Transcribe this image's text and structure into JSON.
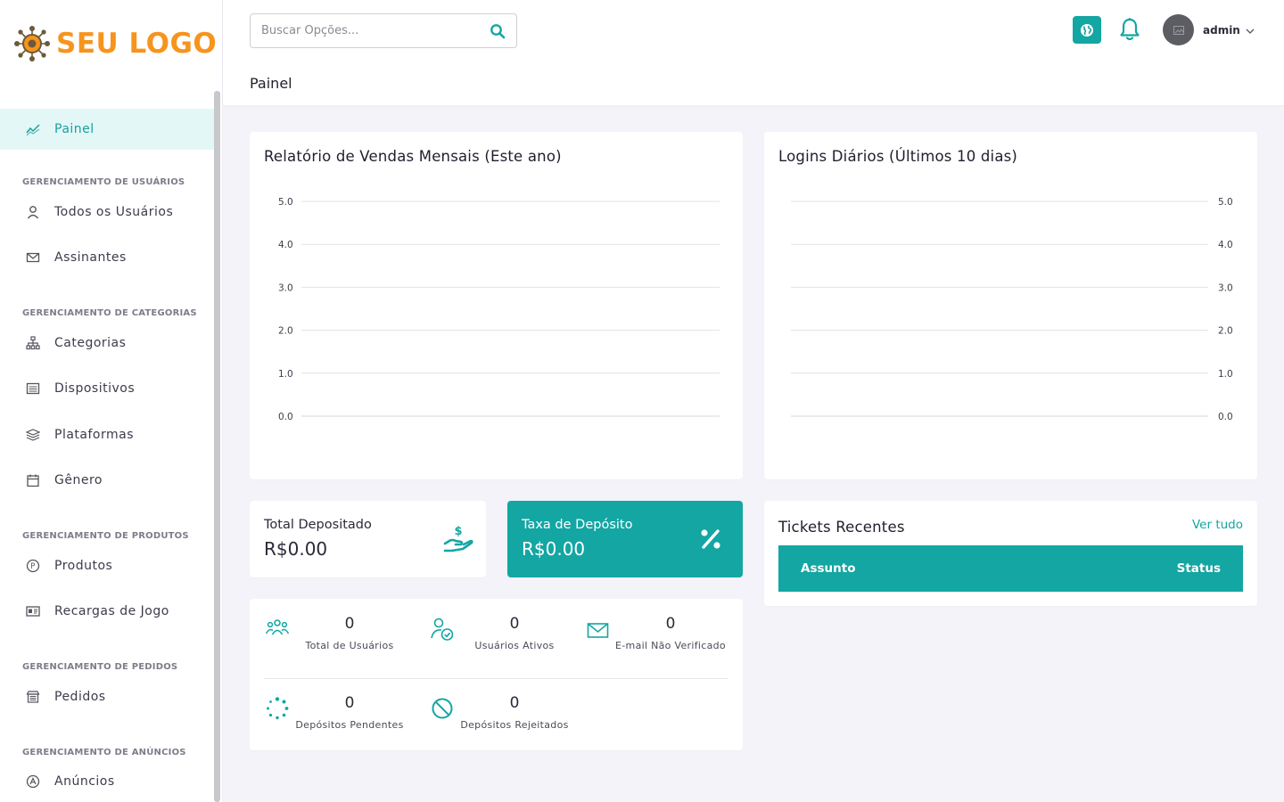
{
  "brand": {
    "logo_text": "SEU LOGO",
    "logo_color": "#f7941d",
    "accent": "#13a6a3"
  },
  "sidebar": {
    "items": [
      {
        "type": "item",
        "label": "Painel",
        "icon": "chart-line-icon",
        "active": true
      },
      {
        "type": "header",
        "label": "GERENCIAMENTO DE USUÁRIOS"
      },
      {
        "type": "item",
        "label": "Todos os Usuários",
        "icon": "user-icon"
      },
      {
        "type": "item",
        "label": "Assinantes",
        "icon": "envelope-icon"
      },
      {
        "type": "header",
        "label": "GERENCIAMENTO DE CATEGORIAS"
      },
      {
        "type": "item",
        "label": "Categorias",
        "icon": "sitemap-icon"
      },
      {
        "type": "item",
        "label": "Dispositivos",
        "icon": "list-box-icon"
      },
      {
        "type": "item",
        "label": "Plataformas",
        "icon": "layers-icon"
      },
      {
        "type": "item",
        "label": "Gênero",
        "icon": "calendar-icon"
      },
      {
        "type": "header",
        "label": "GERENCIAMENTO DE PRODUTOS"
      },
      {
        "type": "item",
        "label": "Produtos",
        "icon": "product-circle-icon"
      },
      {
        "type": "item",
        "label": "Recargas de Jogo",
        "icon": "id-card-icon"
      },
      {
        "type": "header",
        "label": "GERENCIAMENTO DE PEDIDOS"
      },
      {
        "type": "item",
        "label": "Pedidos",
        "icon": "store-icon"
      },
      {
        "type": "header",
        "label": "GERENCIAMENTO DE ANÚNCIOS"
      },
      {
        "type": "item",
        "label": "Anúncios",
        "icon": "ad-circle-icon"
      }
    ]
  },
  "header": {
    "search_placeholder": "Buscar Opções...",
    "page_title": "Painel",
    "user_name": "admin"
  },
  "sales_chart": {
    "title": "Relatório de Vendas Mensais (Este ano)",
    "chart_data": {
      "type": "line",
      "title": "Relatório de Vendas Mensais (Este ano)",
      "x": [],
      "series": [],
      "ylim": [
        0,
        5
      ],
      "yticks": [
        "5.0",
        "4.0",
        "3.0",
        "2.0",
        "1.0",
        "0.0"
      ],
      "grid": true,
      "y_axis_side": "left"
    }
  },
  "logins_chart": {
    "title": "Logins Diários (Últimos 10 dias)",
    "chart_data": {
      "type": "line",
      "title": "Logins Diários (Últimos 10 dias)",
      "x": [],
      "series": [],
      "ylim": [
        0,
        5
      ],
      "yticks": [
        "5.0",
        "4.0",
        "3.0",
        "2.0",
        "1.0",
        "0.0"
      ],
      "grid": true,
      "y_axis_side": "right"
    }
  },
  "deposit_total": {
    "label": "Total Depositado",
    "value": "R$0.00"
  },
  "deposit_fee": {
    "label": "Taxa de Depósito",
    "value": "R$0.00"
  },
  "widgets": [
    {
      "num": "0",
      "label": "Total de Usuários",
      "icon": "users-group-icon"
    },
    {
      "num": "0",
      "label": "Usuários Ativos",
      "icon": "user-check-icon"
    },
    {
      "num": "0",
      "label": "E-mail Não Verificado",
      "icon": "envelope-icon"
    },
    {
      "num": "0",
      "label": "Depósitos Pendentes",
      "icon": "spinner-icon"
    },
    {
      "num": "0",
      "label": "Depósitos Rejeitados",
      "icon": "ban-icon"
    }
  ],
  "tickets": {
    "title": "Tickets Recentes",
    "view_all": "Ver tudo",
    "col_subject": "Assunto",
    "col_status": "Status"
  }
}
